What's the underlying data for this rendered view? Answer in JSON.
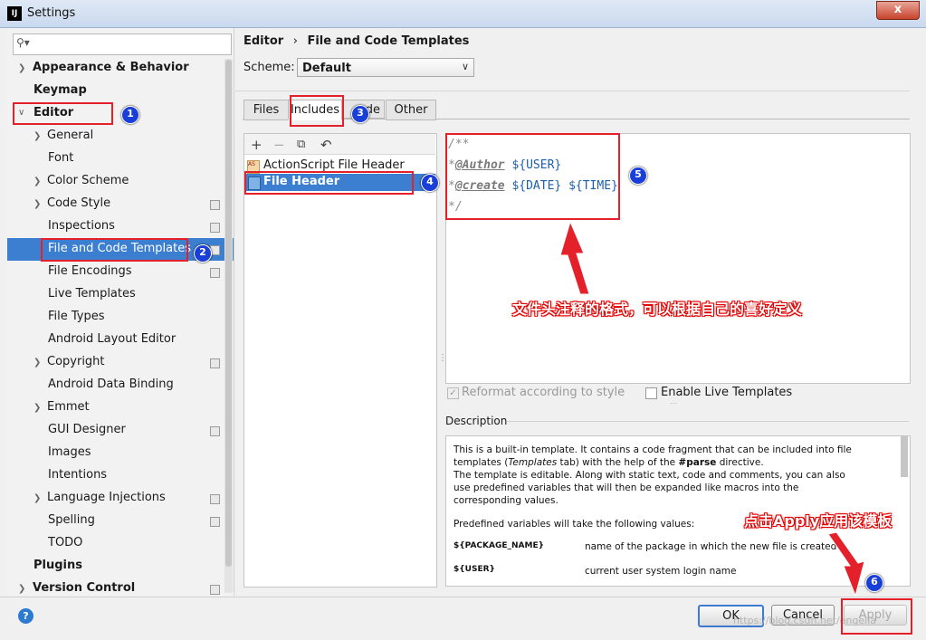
{
  "window": {
    "title": "Settings",
    "app_icon": "IJ",
    "close": "x"
  },
  "sidebar": {
    "search_placeholder": "",
    "items": [
      {
        "label": "Appearance & Behavior"
      },
      {
        "label": "Keymap"
      },
      {
        "label": "Editor"
      },
      {
        "label": "General"
      },
      {
        "label": "Font"
      },
      {
        "label": "Color Scheme"
      },
      {
        "label": "Code Style"
      },
      {
        "label": "Inspections"
      },
      {
        "label": "File and Code Templates"
      },
      {
        "label": "File Encodings"
      },
      {
        "label": "Live Templates"
      },
      {
        "label": "File Types"
      },
      {
        "label": "Android Layout Editor"
      },
      {
        "label": "Copyright"
      },
      {
        "label": "Android Data Binding"
      },
      {
        "label": "Emmet"
      },
      {
        "label": "GUI Designer"
      },
      {
        "label": "Images"
      },
      {
        "label": "Intentions"
      },
      {
        "label": "Language Injections"
      },
      {
        "label": "Spelling"
      },
      {
        "label": "TODO"
      },
      {
        "label": "Plugins"
      },
      {
        "label": "Version Control"
      }
    ]
  },
  "breadcrumb": {
    "part1": "Editor",
    "sep": "›",
    "part2": "File and Code Templates"
  },
  "scheme": {
    "label": "Scheme:",
    "value": "Default"
  },
  "tabs": [
    {
      "label": "Files"
    },
    {
      "label": "Includes"
    },
    {
      "label": "de"
    },
    {
      "label": "Other"
    }
  ],
  "templates": {
    "items": [
      {
        "label": "ActionScript File Header"
      },
      {
        "label": "File Header"
      }
    ]
  },
  "editor": {
    "line1": "/**",
    "line2_star": "*",
    "line2_tag": "@Author",
    "line2_var": " ${USER}",
    "line3_star": "*",
    "line3_tag": "@create",
    "line3_var": " ${DATE} ${TIME}",
    "line4": "*/"
  },
  "options": {
    "reformat_label": "Reformat according to style",
    "live_templates_label": "Enable Live Templates"
  },
  "description": {
    "title": "Description",
    "p1": "This is a built-in template. It contains a code fragment that can be included into file",
    "p2a": "templates (",
    "p2b": "Templates",
    "p2c": " tab) with the help of the ",
    "p2d": "#parse",
    "p2e": " directive.",
    "p3": "The template is editable. Along with static text, code and comments, you can also",
    "p4": "use predefined variables that will then be expanded like macros into the",
    "p5": "corresponding values.",
    "p6": "Predefined variables will take the following values:",
    "var1_name": "${PACKAGE_NAME}",
    "var1_desc": "name of the package in which the new file is created",
    "var2_name": "${USER}",
    "var2_desc": "current user system login name"
  },
  "buttons": {
    "ok": "OK",
    "cancel": "Cancel",
    "apply": "Apply",
    "help": "?"
  },
  "annotations": {
    "b1": "1",
    "b2": "2",
    "b3": "3",
    "b4": "4",
    "b5": "5",
    "b6": "6",
    "note_format": "文件头注释的格式，可以根据自己的喜好定义",
    "note_apply": "点击Apply应用该模板",
    "watermark": "https://blog.csdn.net/engelia"
  },
  "colors": {
    "selection": "#3c7fd0",
    "annotation_red": "#e4212a",
    "badge_blue": "#1a3fd8"
  }
}
